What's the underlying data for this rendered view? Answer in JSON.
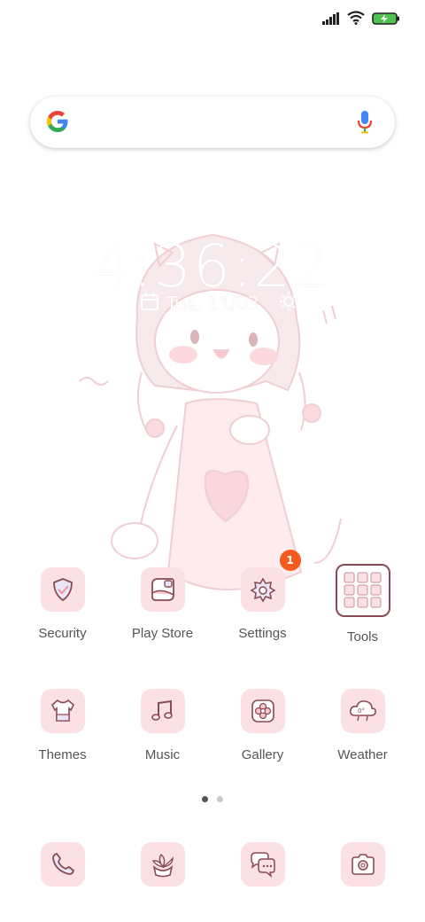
{
  "status_bar": {
    "icons": [
      "signal-icon",
      "wifi-icon",
      "battery-charging-icon"
    ],
    "battery_color": "#4fc24f"
  },
  "search_bar": {
    "icons": [
      "google-logo-icon",
      "microphone-icon"
    ]
  },
  "lock_widget": {
    "time": "4:36:22",
    "date": "Tue, 11/03",
    "icons": [
      "calendar-icon",
      "sun-icon"
    ]
  },
  "home_apps": [
    {
      "label": "Security",
      "icon": "shield-check-icon"
    },
    {
      "label": "Play Store",
      "icon": "play-store-icon"
    },
    {
      "label": "Settings",
      "icon": "gear-icon",
      "badge": "1"
    },
    {
      "label": "Tools",
      "icon": "tools-folder-icon"
    },
    {
      "label": "Themes",
      "icon": "themes-shirt-icon"
    },
    {
      "label": "Music",
      "icon": "music-note-icon"
    },
    {
      "label": "Gallery",
      "icon": "gallery-flower-icon"
    },
    {
      "label": "Weather",
      "icon": "weather-cloud-icon"
    }
  ],
  "page_indicator": {
    "pages": 2,
    "active": 1
  },
  "dock": [
    {
      "icon": "phone-icon"
    },
    {
      "icon": "plant-icon"
    },
    {
      "icon": "messaging-icon"
    },
    {
      "icon": "camera-icon"
    }
  ],
  "colors": {
    "tile_bg": "#fbe1e4",
    "icon_line": "#8a4b55",
    "badge": "#f55a1e",
    "label_text": "#555555"
  }
}
